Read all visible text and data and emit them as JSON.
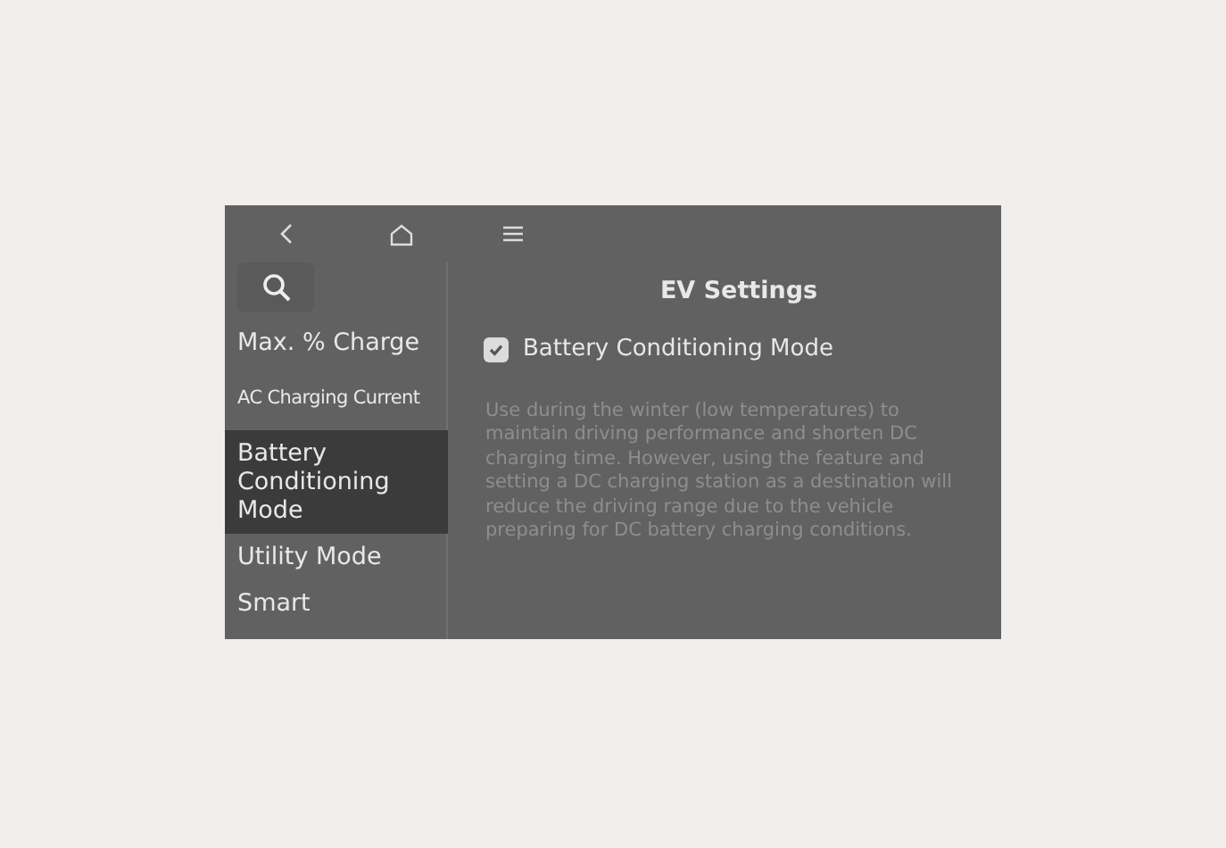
{
  "title": "EV Settings",
  "sidebar": {
    "items": [
      {
        "label": "Max. % Charge",
        "kind": "normal",
        "selected": false
      },
      {
        "label": "AC Charging Current",
        "kind": "compact",
        "selected": false
      },
      {
        "label": "Battery Conditioning Mode",
        "kind": "normal",
        "selected": true
      },
      {
        "label": "Utility Mode",
        "kind": "normal",
        "selected": false
      },
      {
        "label": "Smart",
        "kind": "normal",
        "selected": false
      }
    ]
  },
  "option": {
    "label": "Battery Conditioning Mode",
    "checked": true
  },
  "description": "Use during the winter (low temperatures) to maintain driving performance and shorten DC charging time. However, using the feature and setting a DC charging station as a destination will reduce the driving range due to the vehicle preparing for DC battery charging conditions."
}
